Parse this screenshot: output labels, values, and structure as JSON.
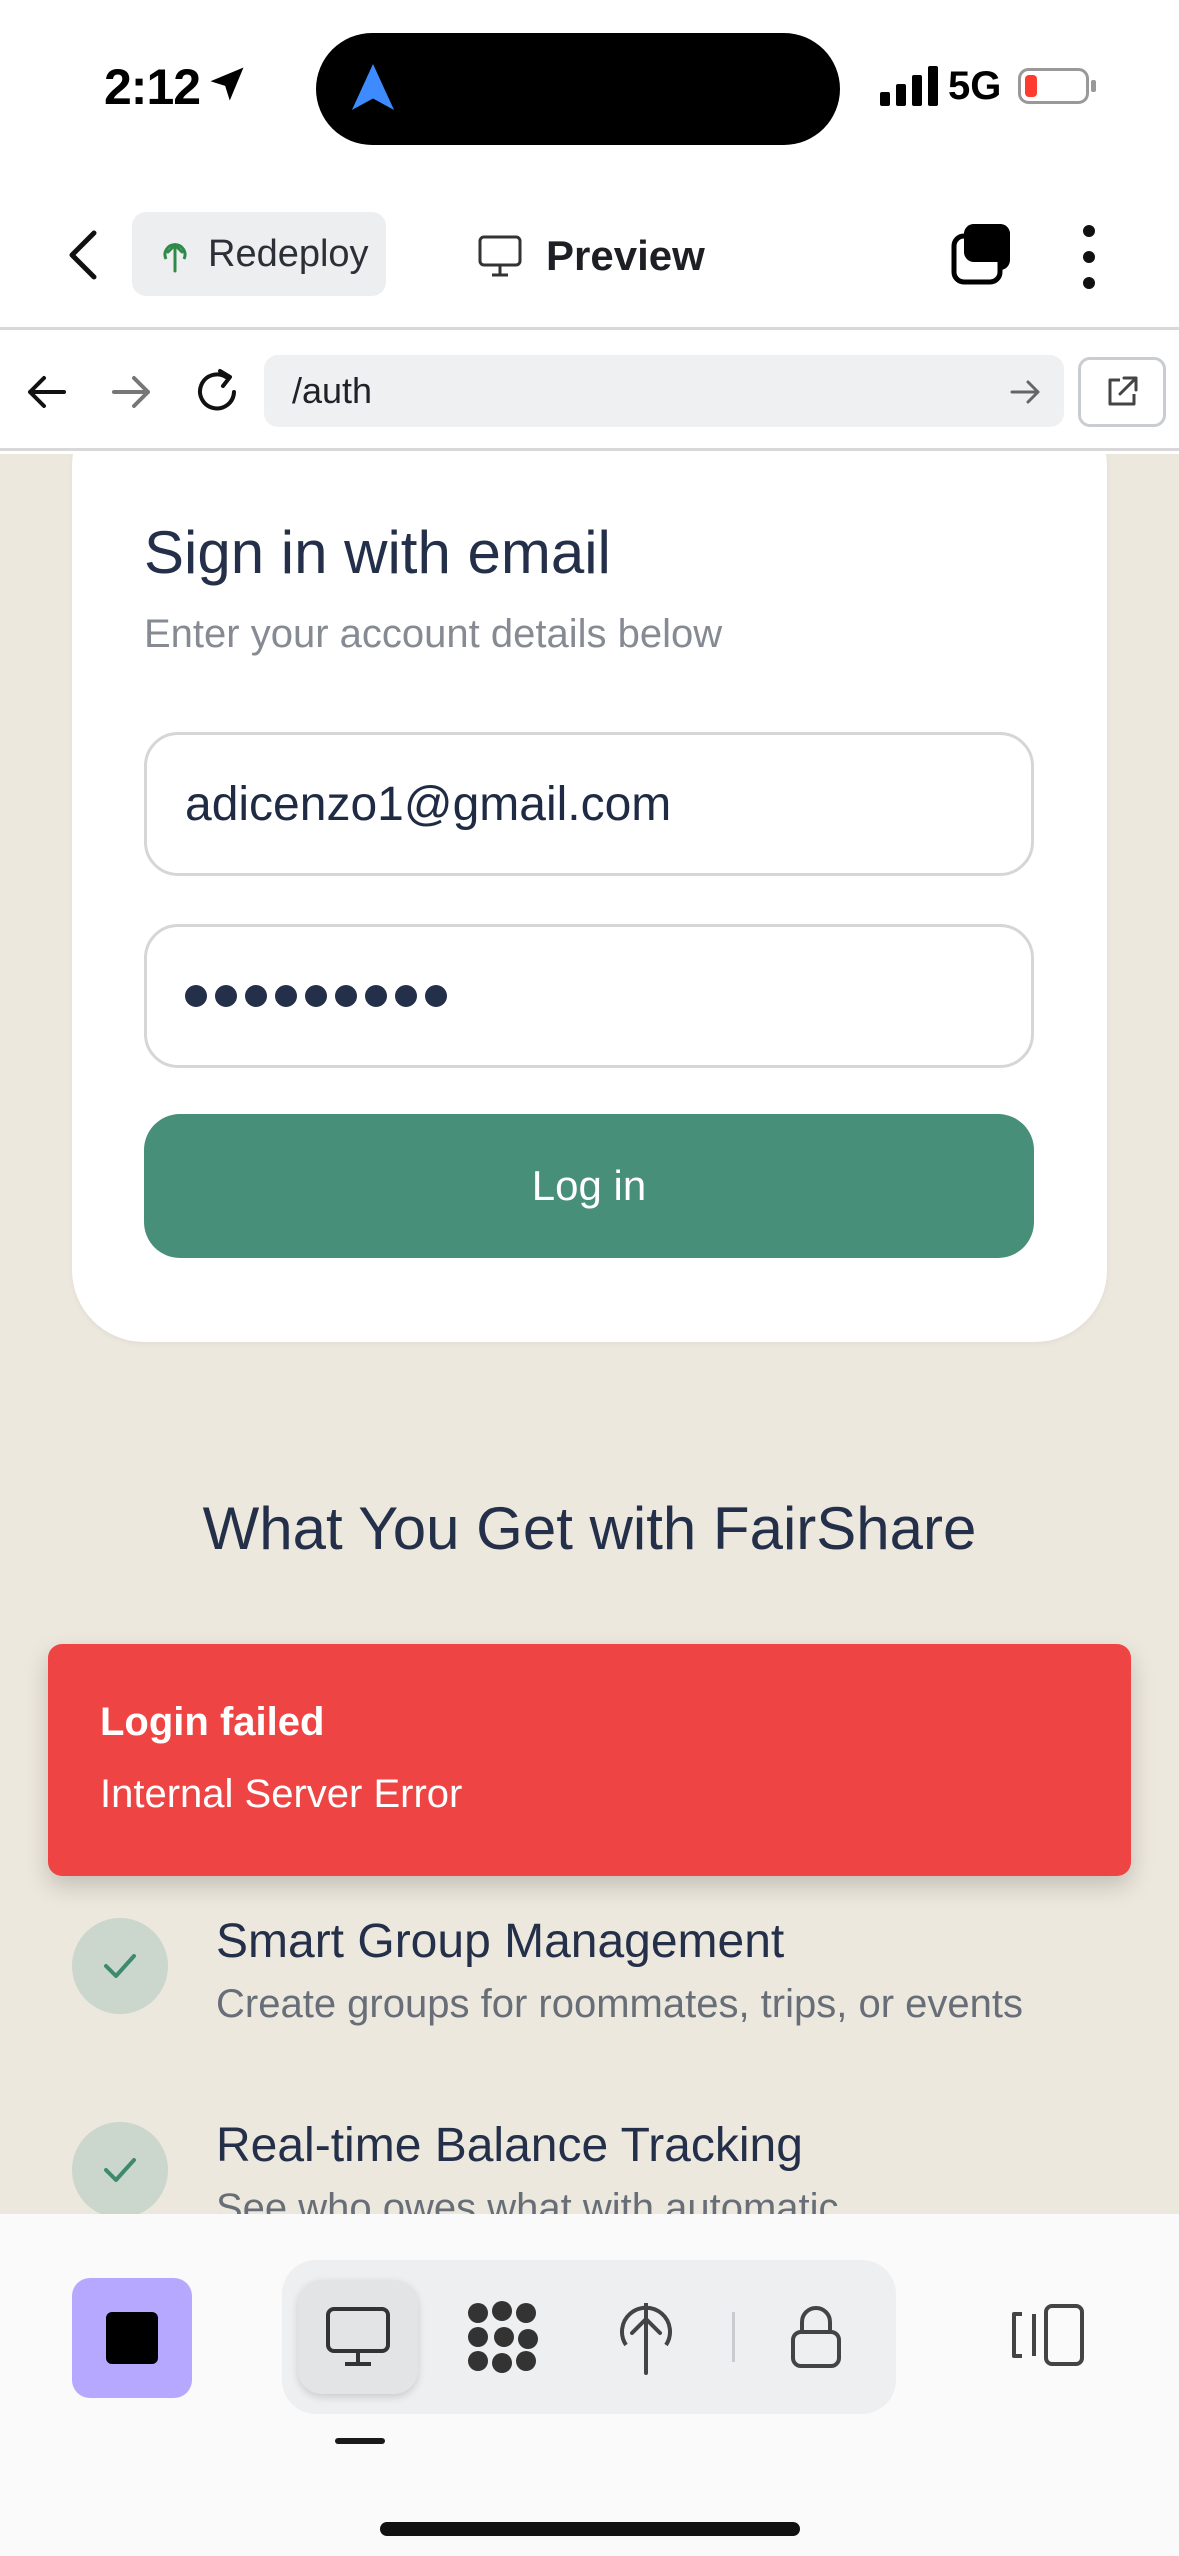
{
  "status_bar": {
    "time": "2:12",
    "network": "5G"
  },
  "header": {
    "redeploy_label": "Redeploy",
    "preview_label": "Preview"
  },
  "browser": {
    "url": "/auth"
  },
  "login": {
    "title": "Sign in with email",
    "subtitle": "Enter your account details below",
    "email_value": "adicenzo1@gmail.com",
    "password_masked": "•••••••••",
    "login_button": "Log in"
  },
  "features_section": {
    "title": "What You Get with FairShare",
    "items": [
      {
        "title": "Smart Group Management",
        "description": "Create groups for roommates, trips, or events"
      },
      {
        "title": "Real-time Balance Tracking",
        "description": "See who owes what with automatic"
      }
    ]
  },
  "toast": {
    "title": "Login failed",
    "message": "Internal Server Error"
  },
  "colors": {
    "page_bg": "#ede8de",
    "primary_button": "#478f78",
    "toast_bg": "#ef4444",
    "stop_button": "#b6a8ff"
  }
}
